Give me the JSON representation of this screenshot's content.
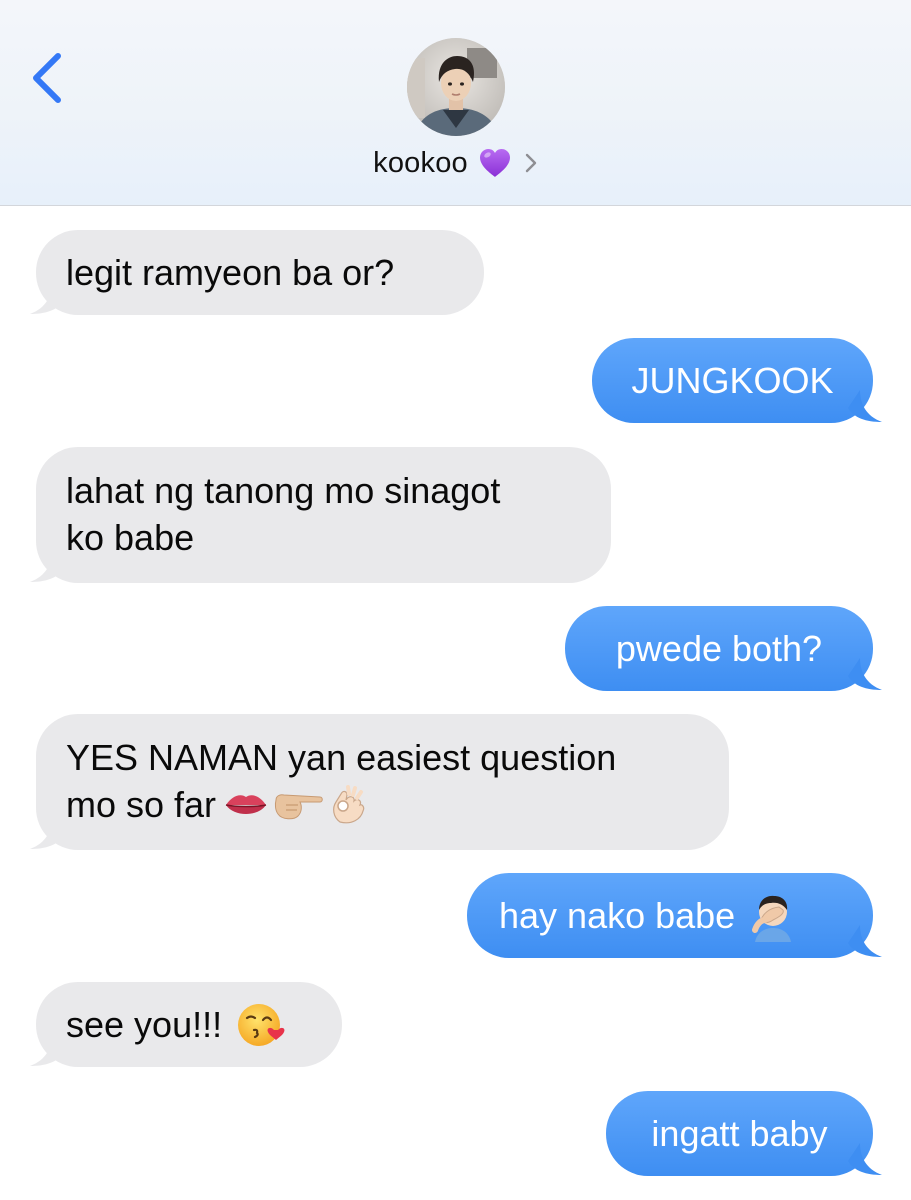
{
  "header": {
    "contact_name": "kookoo",
    "avatar_desc": "contact-photo",
    "heart_icon": "purple-heart-emoji",
    "accent": "#3478f6"
  },
  "messages": [
    {
      "side": "in",
      "text": "legit ramyeon ba or?"
    },
    {
      "side": "out",
      "text": "JUNGKOOK"
    },
    {
      "side": "in",
      "text": "lahat ng tanong mo sinagot",
      "text2": "ko babe"
    },
    {
      "side": "out",
      "text": "pwede both?"
    },
    {
      "side": "in",
      "text": "YES NAMAN yan easiest question",
      "text2": "mo so far",
      "emojis": [
        "lips",
        "pointing-right",
        "ok-hand"
      ]
    },
    {
      "side": "out",
      "text": "hay nako babe",
      "emojis": [
        "facepalm"
      ]
    },
    {
      "side": "in",
      "text": "see you!!!",
      "emojis": [
        "face-blowing-kiss"
      ]
    },
    {
      "side": "out",
      "text": "ingatt baby"
    }
  ],
  "colors": {
    "incoming_bubble": "#e9e9eb",
    "outgoing_bubble": "#3e8ef2",
    "header_bg": "#eef3f9"
  }
}
